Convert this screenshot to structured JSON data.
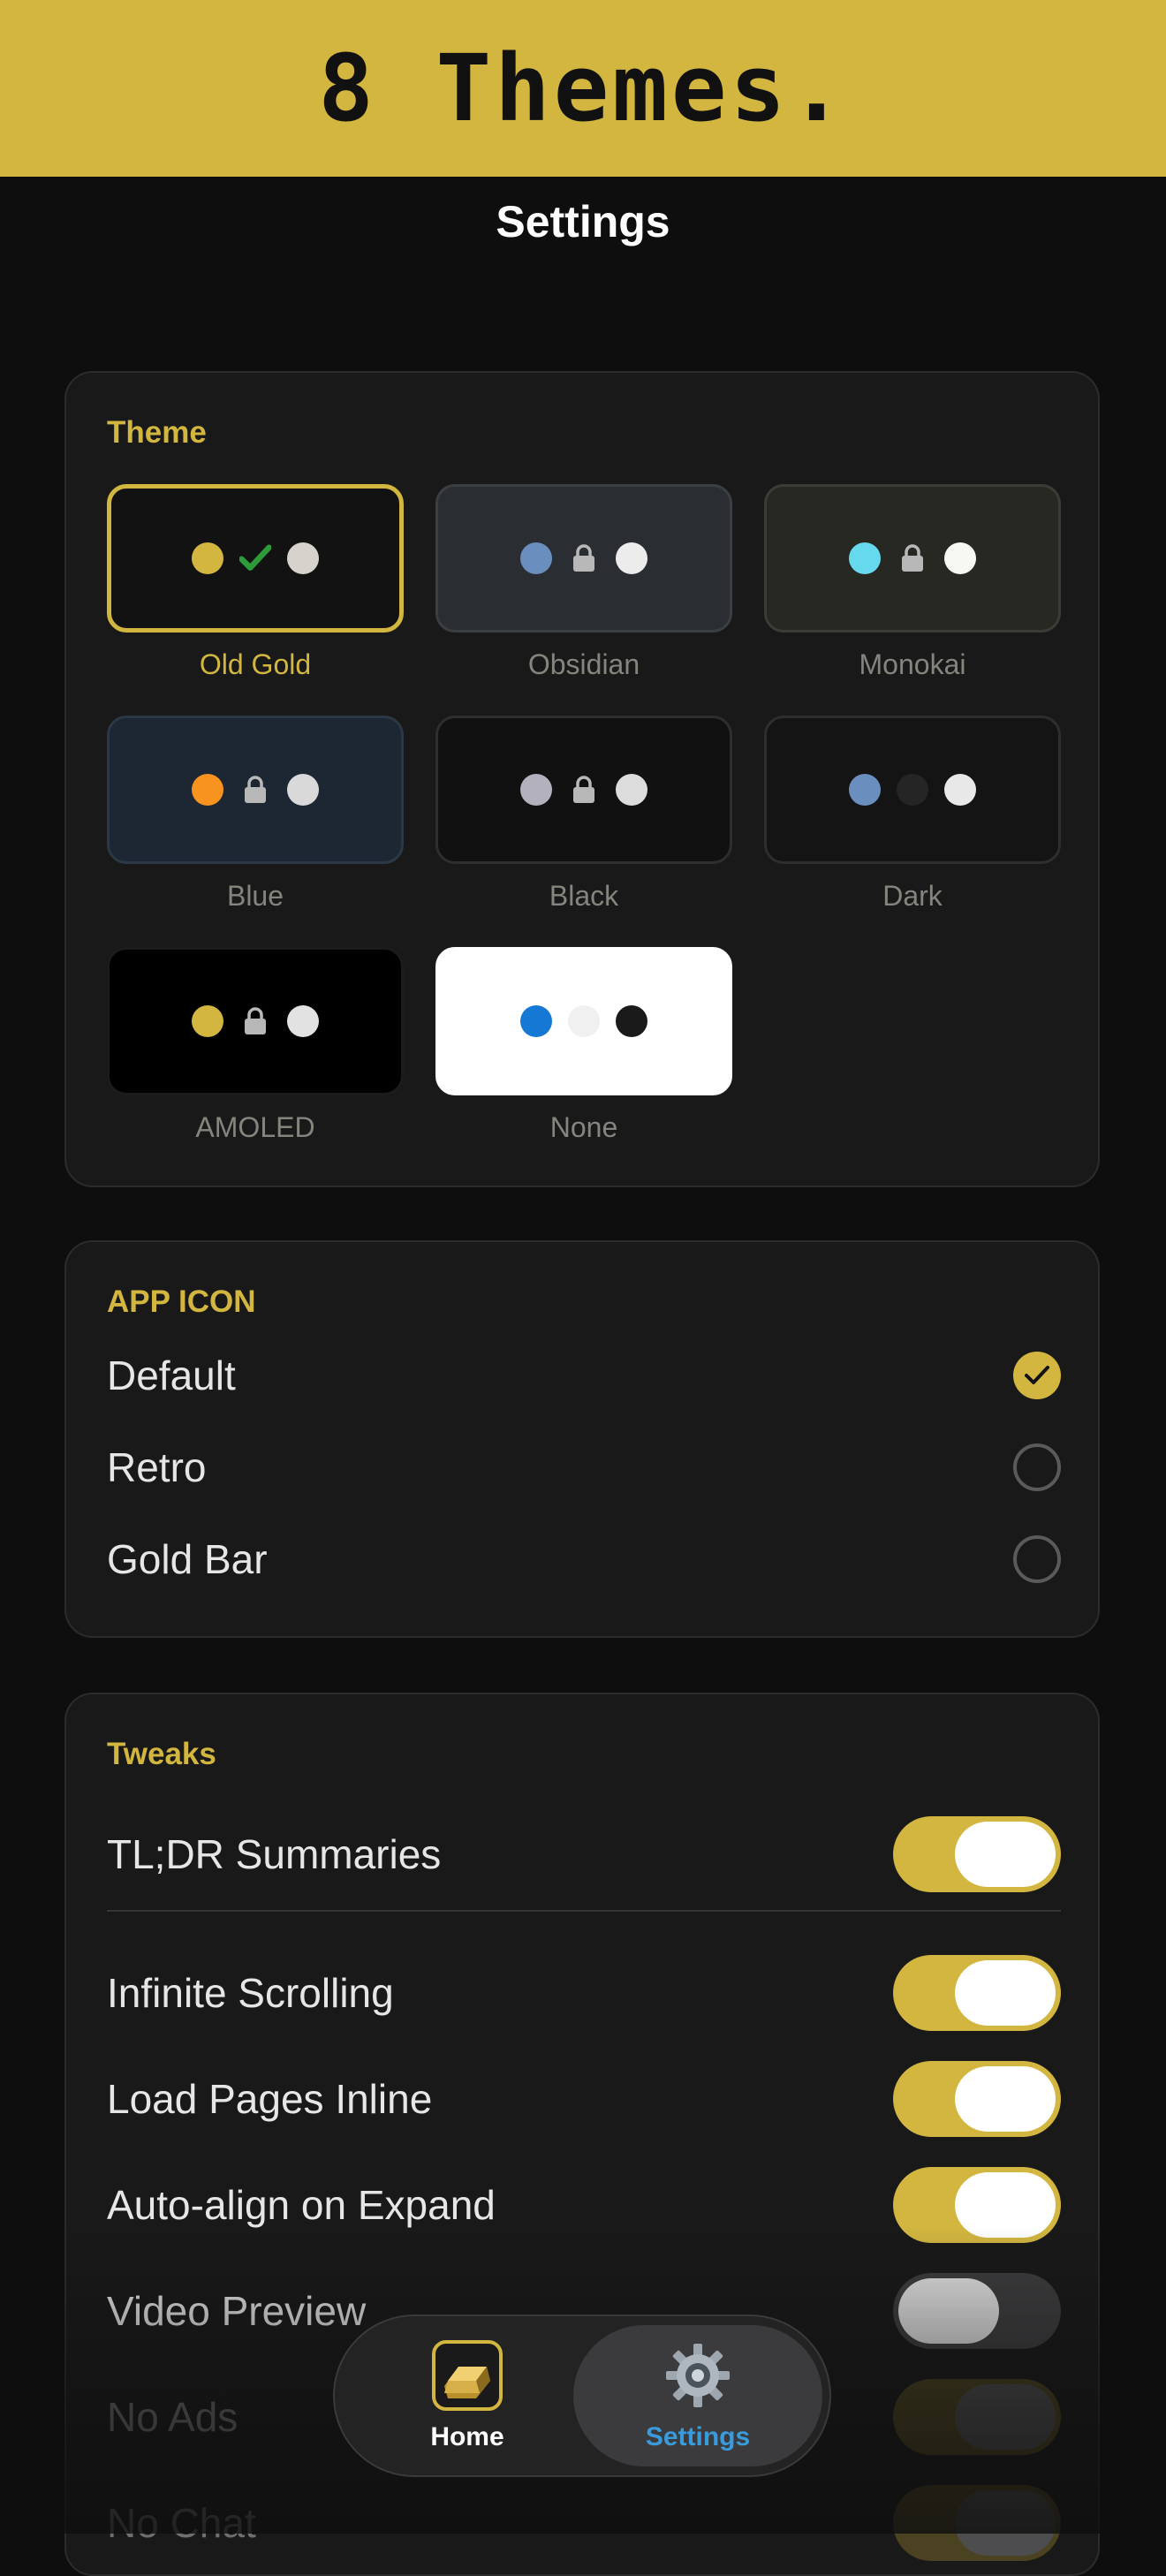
{
  "banner": {
    "text": "8 Themes."
  },
  "nav": {
    "title": "Settings"
  },
  "theme_section": {
    "label": "Theme",
    "themes": [
      {
        "name": "Old Gold",
        "selected": true,
        "bg": "#121212",
        "dot1": "#d2b640",
        "mid": "check-icon",
        "dot2": "#d6d3cc"
      },
      {
        "name": "Obsidian",
        "selected": false,
        "bg": "#2a2d31",
        "dot1": "#6a8fbf",
        "mid": "lock-icon",
        "dot2": "#ececec"
      },
      {
        "name": "Monokai",
        "selected": false,
        "bg": "#272822",
        "dot1": "#66d9ef",
        "mid": "lock-icon",
        "dot2": "#f8f8f2"
      },
      {
        "name": "Blue",
        "selected": false,
        "bg": "#1c2733",
        "dot1": "#f7931e",
        "mid": "lock-icon",
        "dot2": "#d9d9d9"
      },
      {
        "name": "Black",
        "selected": false,
        "bg": "#111111",
        "dot1": "#b3b1be",
        "mid": "lock-icon",
        "dot2": "#dcdcdc"
      },
      {
        "name": "Dark",
        "selected": false,
        "bg": "#141414",
        "dot1": "#6a8fbf",
        "mid": "dark-dot",
        "dot2": "#e8e8e8"
      },
      {
        "name": "AMOLED",
        "selected": false,
        "bg": "#000000",
        "dot1": "#d2b640",
        "mid": "lock-icon",
        "dot2": "#e2e2e2"
      },
      {
        "name": "None",
        "selected": false,
        "bg": "#ffffff",
        "dot1": "#1478d4",
        "mid": "light-dot",
        "dot2": "#1a1a1a"
      }
    ]
  },
  "app_icon_section": {
    "label": "APP ICON",
    "options": [
      {
        "label": "Default",
        "checked": true
      },
      {
        "label": "Retro",
        "checked": false
      },
      {
        "label": "Gold Bar",
        "checked": false
      }
    ]
  },
  "tweaks_section": {
    "label": "Tweaks",
    "items": [
      {
        "label": "TL;DR Summaries",
        "on": true
      },
      {
        "label": "Infinite Scrolling",
        "on": true
      },
      {
        "label": "Load Pages Inline",
        "on": true
      },
      {
        "label": "Auto-align on Expand",
        "on": true
      },
      {
        "label": "Video Preview",
        "on": false
      },
      {
        "label": "No Ads",
        "on": true
      },
      {
        "label": "No Chat",
        "on": true
      }
    ]
  },
  "tabbar": {
    "home_label": "Home",
    "settings_label": "Settings",
    "home_icon": "gold-bar-icon",
    "settings_icon": "gear-icon",
    "active_color": "#3a9bdc"
  },
  "colors": {
    "accent": "#d2b640",
    "background": "#0e0e0e",
    "card": "#191919"
  }
}
